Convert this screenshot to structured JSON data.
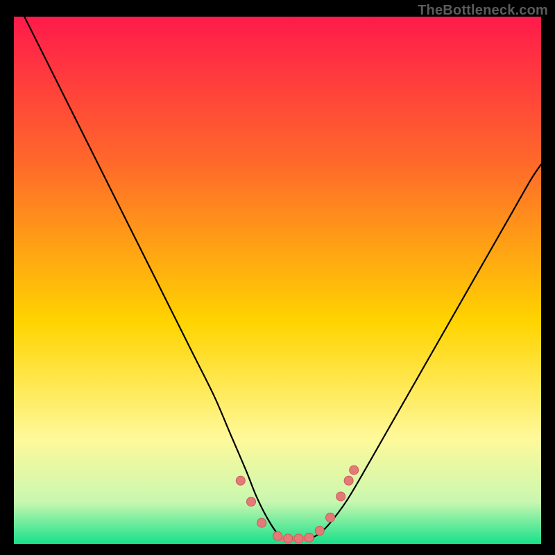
{
  "watermark": "TheBottleneck.com",
  "colors": {
    "bg_black": "#000000",
    "grad_top": "#ff1a4b",
    "grad_mid1": "#ff6a2a",
    "grad_mid2": "#ffd400",
    "grad_low1": "#fff99a",
    "grad_low2": "#c9f7b0",
    "grad_bottom": "#18e08a",
    "curve": "#000000",
    "marker_fill": "#e47a78",
    "marker_stroke": "#c85b58",
    "watermark": "#5c5c5c"
  },
  "chart_data": {
    "type": "line",
    "title": "",
    "xlabel": "",
    "ylabel": "",
    "xlim": [
      0,
      100
    ],
    "ylim": [
      0,
      100
    ],
    "grid": false,
    "series": [
      {
        "name": "bottleneck-curve",
        "x": [
          2,
          6,
          10,
          14,
          18,
          22,
          26,
          30,
          34,
          38,
          41,
          44,
          46,
          48,
          50,
          52,
          54,
          56,
          58,
          60,
          63,
          66,
          70,
          74,
          78,
          82,
          86,
          90,
          94,
          98,
          100
        ],
        "y": [
          100,
          92,
          84,
          76,
          68,
          60,
          52,
          44,
          36,
          28,
          21,
          14,
          9,
          5,
          2,
          1,
          1,
          1,
          2,
          4,
          8,
          13,
          20,
          27,
          34,
          41,
          48,
          55,
          62,
          69,
          72
        ]
      }
    ],
    "markers": [
      {
        "x": 43,
        "y": 12
      },
      {
        "x": 45,
        "y": 8
      },
      {
        "x": 47,
        "y": 4
      },
      {
        "x": 50,
        "y": 1.5
      },
      {
        "x": 52,
        "y": 1
      },
      {
        "x": 54,
        "y": 1
      },
      {
        "x": 56,
        "y": 1.2
      },
      {
        "x": 58,
        "y": 2.5
      },
      {
        "x": 60,
        "y": 5
      },
      {
        "x": 62,
        "y": 9
      },
      {
        "x": 63.5,
        "y": 12
      },
      {
        "x": 64.5,
        "y": 14
      }
    ],
    "flat_band": {
      "y": 1,
      "x_start": 50,
      "x_end": 57
    }
  }
}
